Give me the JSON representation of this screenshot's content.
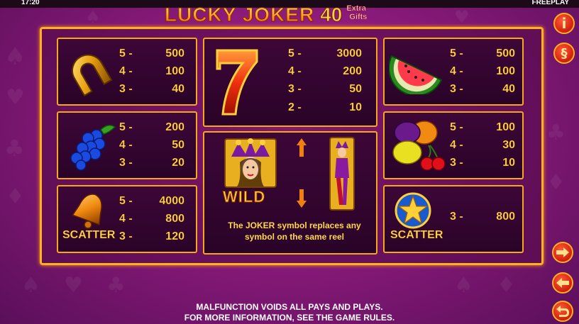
{
  "status_bar": {
    "clock": "17:20",
    "mode": "FREEPLAY"
  },
  "logo": {
    "main": "LUCKY JOKER",
    "number": "40",
    "extra_line1": "Extra",
    "extra_line2": "Gifts"
  },
  "paytable": {
    "horseshoe": {
      "icon": "horseshoe-icon",
      "rows": [
        {
          "count": "5 -",
          "pay": "500"
        },
        {
          "count": "4 -",
          "pay": "100"
        },
        {
          "count": "3 -",
          "pay": "40"
        }
      ]
    },
    "seven": {
      "icon": "seven-icon",
      "rows": [
        {
          "count": "5 -",
          "pay": "3000"
        },
        {
          "count": "4 -",
          "pay": "200"
        },
        {
          "count": "3 -",
          "pay": "50"
        },
        {
          "count": "2 -",
          "pay": "10"
        }
      ]
    },
    "watermelon": {
      "icon": "watermelon-icon",
      "rows": [
        {
          "count": "5 -",
          "pay": "500"
        },
        {
          "count": "4 -",
          "pay": "100"
        },
        {
          "count": "3 -",
          "pay": "40"
        }
      ]
    },
    "grapes": {
      "icon": "grapes-icon",
      "rows": [
        {
          "count": "5 -",
          "pay": "200"
        },
        {
          "count": "4 -",
          "pay": "50"
        },
        {
          "count": "3 -",
          "pay": "20"
        }
      ]
    },
    "fruits": {
      "icon": "fruits-icon",
      "rows": [
        {
          "count": "5 -",
          "pay": "100"
        },
        {
          "count": "4 -",
          "pay": "30"
        },
        {
          "count": "3 -",
          "pay": "10"
        }
      ]
    },
    "bell": {
      "icon": "bell-icon",
      "label": "SCATTER",
      "rows": [
        {
          "count": "5 -",
          "pay": "4000"
        },
        {
          "count": "4 -",
          "pay": "800"
        },
        {
          "count": "3 -",
          "pay": "120"
        }
      ]
    },
    "star": {
      "icon": "star-icon",
      "label": "SCATTER",
      "rows": [
        {
          "count": "3 -",
          "pay": "800"
        }
      ]
    },
    "wild": {
      "label": "WILD",
      "description_line1": "The JOKER symbol replaces any",
      "description_line2": "symbol on the same reel"
    }
  },
  "footer": {
    "line1": "MALFUNCTION VOIDS ALL PAYS AND PLAYS.",
    "line2": "FOR MORE INFORMATION, SEE THE GAME RULES."
  },
  "buttons": {
    "info": "i",
    "rules": "§"
  },
  "colors": {
    "frame": "#ffb020",
    "text": "#ffd84a",
    "button": "#d0200a"
  }
}
